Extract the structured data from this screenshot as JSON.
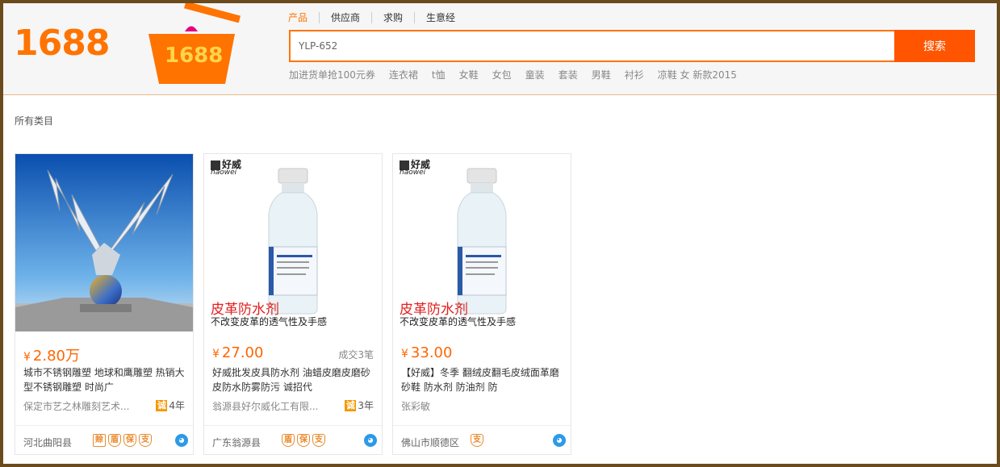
{
  "header": {
    "logo": "1688",
    "basket_logo": "1688",
    "nav": [
      {
        "label": "产品",
        "active": true
      },
      {
        "label": "供应商",
        "active": false
      },
      {
        "label": "求购",
        "active": false
      },
      {
        "label": "生意经",
        "active": false
      }
    ],
    "search": {
      "value": "YLP-652",
      "button_label": "搜索"
    },
    "hot_words": [
      "加进货单抢100元券",
      "连衣裙",
      "t恤",
      "女鞋",
      "女包",
      "童装",
      "套装",
      "男鞋",
      "衬衫",
      "凉鞋 女 新款2015"
    ]
  },
  "category": {
    "label": "所有类目"
  },
  "colors": {
    "accent": "#ff7300",
    "search_button": "#ff5500",
    "price": "#ff6600",
    "border": "#6b4a1e"
  },
  "products": [
    {
      "image_icon": "sculpture-image",
      "price_symbol": "¥",
      "price": "2.80万",
      "sales": "",
      "title": "城市不锈钢雕塑 地球和鹰雕塑 热销大型不锈钢雕塑 时尚广",
      "company": "保定市艺之林雕刻艺术...",
      "cheng": "诚",
      "years": "4年",
      "location": "河北曲阳县",
      "badges": [
        "赊",
        "盾",
        "保",
        "支"
      ]
    },
    {
      "image_icon": "waterproof-bottle-image",
      "image_brand": "好威",
      "image_brand_en": "haowei",
      "image_headline": "皮革防水剂",
      "image_subline": "不改变皮革的透气性及手感",
      "price_symbol": "¥",
      "price": "27.00",
      "sales": "成交3笔",
      "title": "好威批发皮具防水剂 油蜡皮磨皮磨砂皮防水防雾防污 诚招代",
      "company": "翁源县好尔威化工有限...",
      "cheng": "诚",
      "years": "3年",
      "location": "广东翁源县",
      "badges": [
        "盾",
        "保",
        "支"
      ]
    },
    {
      "image_icon": "waterproof-bottle-image",
      "image_brand": "好威",
      "image_brand_en": "haowei",
      "image_headline": "皮革防水剂",
      "image_subline": "不改变皮革的透气性及手感",
      "price_symbol": "¥",
      "price": "33.00",
      "sales": "",
      "title": "【好威】冬季 翻绒皮翻毛皮绒面革磨砂鞋 防水剂 防油剂 防",
      "company": "张彩敏",
      "cheng": "",
      "years": "",
      "location": "佛山市顺德区",
      "badges": [
        "支"
      ]
    }
  ]
}
